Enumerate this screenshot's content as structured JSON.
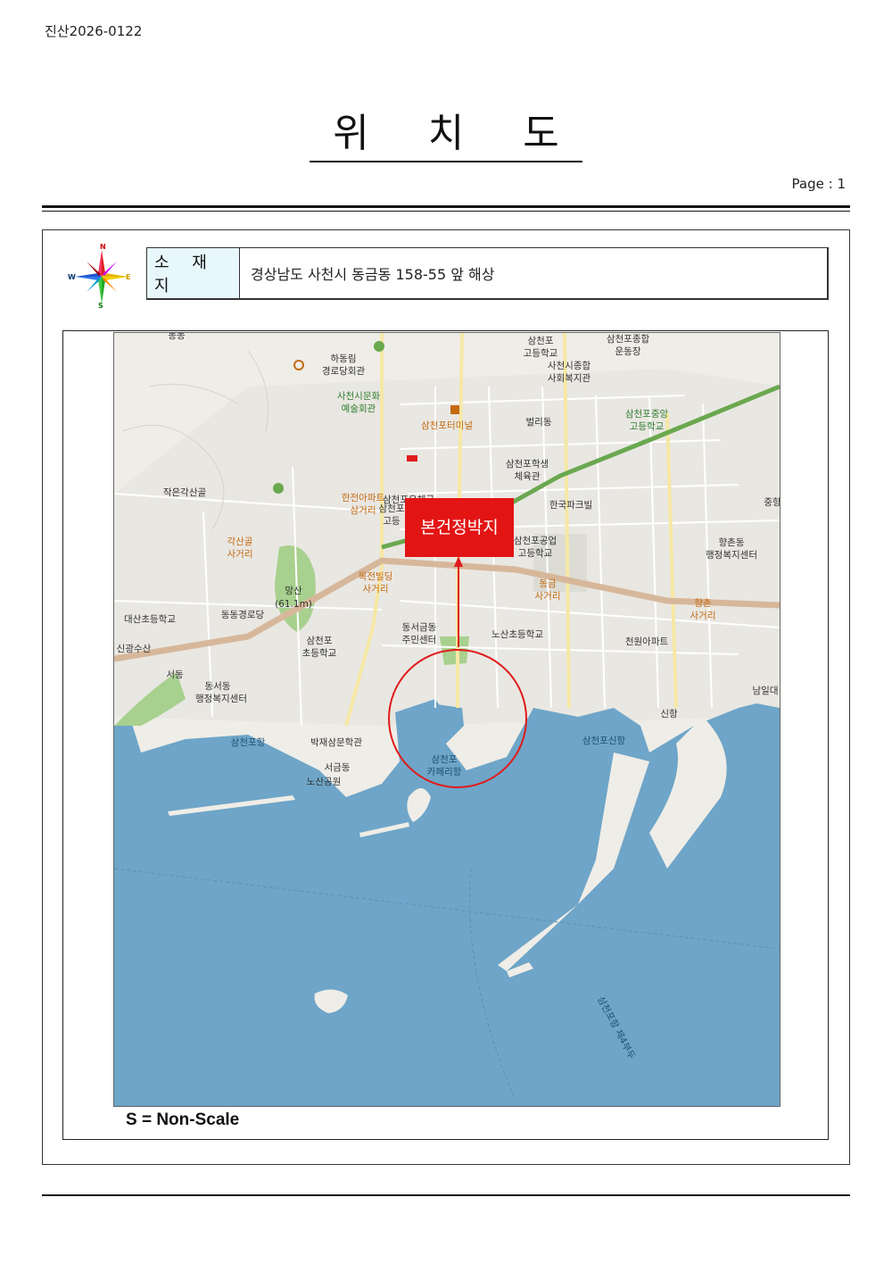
{
  "document": {
    "doc_number": "진산2026-0122",
    "title": "위 치 도",
    "page_label": "Page  :  1"
  },
  "compass": {
    "n": "N",
    "s": "S",
    "e": "E",
    "w": "W"
  },
  "address": {
    "label": "소 재 지",
    "value": "경상남도 사천시 동금동 158-55 앞 해상"
  },
  "map": {
    "callout": "본건정박지",
    "scale_note": "S = Non-Scale",
    "colors": {
      "sea": "#6ea5c8",
      "land": "#efede7",
      "park": "#a8d08e",
      "main_road": "#d7b79a",
      "rail": "#6aa84f",
      "callout": "#e31414",
      "marker": "#e01b1b"
    },
    "labels": [
      {
        "text": "동동",
        "cls": "lbl"
      },
      {
        "text": "하동림",
        "cls": "lbl"
      },
      {
        "text": "경로당회관",
        "cls": "lbl"
      },
      {
        "text": "사천시문화",
        "cls": "lbl lbl-g"
      },
      {
        "text": "예술회관",
        "cls": "lbl lbl-g"
      },
      {
        "text": "삼천포터미널",
        "cls": "lbl lbl-o"
      },
      {
        "text": "벌리동",
        "cls": "lbl"
      },
      {
        "text": "삼천포",
        "cls": "lbl"
      },
      {
        "text": "고등학교",
        "cls": "lbl"
      },
      {
        "text": "삼천포종합",
        "cls": "lbl"
      },
      {
        "text": "운동장",
        "cls": "lbl"
      },
      {
        "text": "사천시종합",
        "cls": "lbl"
      },
      {
        "text": "사회복지관",
        "cls": "lbl"
      },
      {
        "text": "삼천포중앙",
        "cls": "lbl lbl-g"
      },
      {
        "text": "고등학교",
        "cls": "lbl lbl-g"
      },
      {
        "text": "삼천포학생",
        "cls": "lbl"
      },
      {
        "text": "체육관",
        "cls": "lbl"
      },
      {
        "text": "작은각산골",
        "cls": "lbl"
      },
      {
        "text": "한전아파트",
        "cls": "lbl lbl-o"
      },
      {
        "text": "삼거리",
        "cls": "lbl lbl-o"
      },
      {
        "text": "삼천포우체국",
        "cls": "lbl"
      },
      {
        "text": "한국파크빌",
        "cls": "lbl"
      },
      {
        "text": "중항",
        "cls": "lbl"
      },
      {
        "text": "각산골",
        "cls": "lbl lbl-o"
      },
      {
        "text": "사거리",
        "cls": "lbl lbl-o"
      },
      {
        "text": "삼천포",
        "cls": "lbl"
      },
      {
        "text": "고등",
        "cls": "lbl"
      },
      {
        "text": "삼천포공업",
        "cls": "lbl"
      },
      {
        "text": "고등학교",
        "cls": "lbl"
      },
      {
        "text": "향촌동",
        "cls": "lbl"
      },
      {
        "text": "행정복지센터",
        "cls": "lbl"
      },
      {
        "text": "망산",
        "cls": "lbl"
      },
      {
        "text": "(61.1m)",
        "cls": "lbl"
      },
      {
        "text": "목전빌딩",
        "cls": "lbl lbl-o"
      },
      {
        "text": "사거리",
        "cls": "lbl lbl-o"
      },
      {
        "text": "동금",
        "cls": "lbl lbl-o"
      },
      {
        "text": "사거리",
        "cls": "lbl lbl-o"
      },
      {
        "text": "향촌",
        "cls": "lbl lbl-o"
      },
      {
        "text": "사거리",
        "cls": "lbl lbl-o"
      },
      {
        "text": "대산초등학교",
        "cls": "lbl"
      },
      {
        "text": "동동경로당",
        "cls": "lbl"
      },
      {
        "text": "동서금동",
        "cls": "lbl"
      },
      {
        "text": "주민센터",
        "cls": "lbl"
      },
      {
        "text": "노산초등학교",
        "cls": "lbl"
      },
      {
        "text": "천원아파트",
        "cls": "lbl"
      },
      {
        "text": "신광수산",
        "cls": "lbl"
      },
      {
        "text": "삼천포",
        "cls": "lbl"
      },
      {
        "text": "초등학교",
        "cls": "lbl"
      },
      {
        "text": "서동",
        "cls": "lbl"
      },
      {
        "text": "동서동",
        "cls": "lbl"
      },
      {
        "text": "행정복지센터",
        "cls": "lbl"
      },
      {
        "text": "남일대",
        "cls": "lbl"
      },
      {
        "text": "신항",
        "cls": "lbl"
      },
      {
        "text": "삼천포항",
        "cls": "lbl lbl-w"
      },
      {
        "text": "박재삼문학관",
        "cls": "lbl"
      },
      {
        "text": "삼천포신항",
        "cls": "lbl lbl-w"
      },
      {
        "text": "삼천포",
        "cls": "lbl lbl-w"
      },
      {
        "text": "카페리항",
        "cls": "lbl lbl-w"
      },
      {
        "text": "서금동",
        "cls": "lbl"
      },
      {
        "text": "노산공원",
        "cls": "lbl"
      },
      {
        "text": "삼천포항 제4부두",
        "cls": "lbl lbl-w"
      }
    ]
  }
}
